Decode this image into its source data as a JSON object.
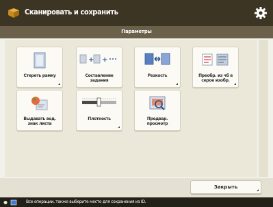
{
  "header": {
    "title": "Сканировать и сохранить",
    "subtitle": "Параметры"
  },
  "tiles": [
    {
      "label": "Стереть рамку"
    },
    {
      "label": "Составление\nзадания"
    },
    {
      "label": "Резкость"
    },
    {
      "label": "Преобр. из чб в\nсерое изобр."
    },
    {
      "label": "Выдавать вод.\nзнак листа"
    },
    {
      "label": "Плотность"
    },
    {
      "label": "Предвар.\nпросмотр"
    }
  ],
  "footer": {
    "close_label": "Закрыть"
  },
  "status": {
    "message": "Все операции, также выберите место для сохранения из ID."
  },
  "colors": {
    "titlebar": "#3d3524",
    "subheader": "#6b6049",
    "panel": "#ebe8da",
    "tile": "#fbfaf4",
    "statusbar": "#232017"
  },
  "icons": {
    "title": "scan-save-icon",
    "settings": "gear-icon"
  }
}
